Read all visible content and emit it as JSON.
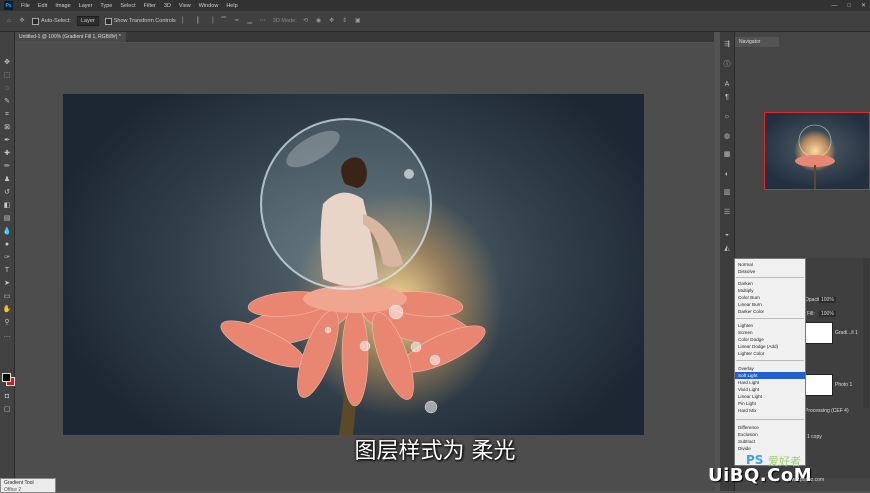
{
  "app": {
    "logo": "Ps"
  },
  "menu": [
    "File",
    "Edit",
    "Image",
    "Layer",
    "Type",
    "Select",
    "Filter",
    "3D",
    "View",
    "Window",
    "Help"
  ],
  "window_controls": [
    "—",
    "□",
    "✕"
  ],
  "options": {
    "auto_select": "Auto-Select:",
    "auto_select_value": "Layer",
    "show_transform": "Show Transform Controls",
    "mode_3d": "3D Mode:"
  },
  "document_tab": "Untitled-1 @ 100% (Gradient Fill 1, RGB/8#) *",
  "panels": {
    "navigator_tab": "Navigator"
  },
  "blend_modes": {
    "group1": [
      "Normal",
      "Dissolve"
    ],
    "group2": [
      "Darken",
      "Multiply",
      "Color Burn",
      "Linear Burn",
      "Darker Color"
    ],
    "group3": [
      "Lighten",
      "Screen",
      "Color Dodge",
      "Linear Dodge (Add)",
      "Lighter Color"
    ],
    "group4": [
      "Overlay",
      "Soft Light",
      "Hard Light",
      "Vivid Light",
      "Linear Light",
      "Pin Light",
      "Hard Mix"
    ],
    "group5": [
      "Difference",
      "Exclusion",
      "Subtract",
      "Divide"
    ],
    "selected": "Soft Light"
  },
  "layers": {
    "opacity_label": "Opacity:",
    "opacity_value": "100%",
    "fill_label": "Fill:",
    "fill_value": "100%",
    "layer1": "Gradi...ll 1",
    "layer2": "Photo 1",
    "processing": "Processing (CEF 4)",
    "copy_label": "1 copy"
  },
  "status_tab": "Gradient Tool",
  "status_sub": "Office 2",
  "caption": "图层样式为 柔光",
  "watermark": {
    "ps": "PS",
    "cn": "爱好者",
    "domain": "UiBQ.CoM",
    "url": "www.psahz.com"
  },
  "colors": {
    "foreground": "#000000",
    "background": "#c42020",
    "highlight": "#1f5fd0",
    "nav_border": "#e02a2a"
  }
}
